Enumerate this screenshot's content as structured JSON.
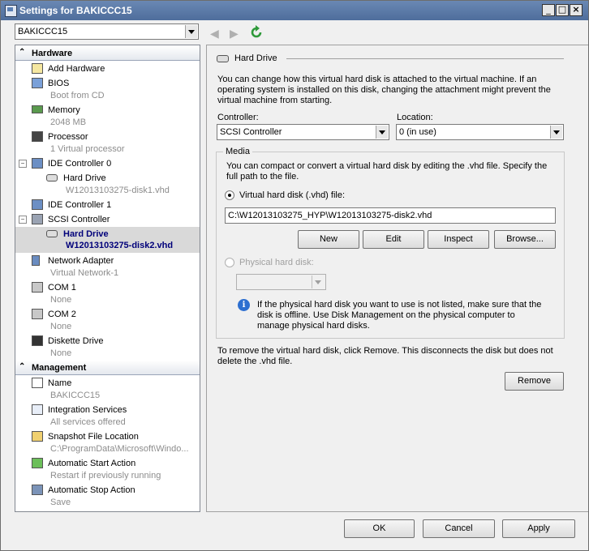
{
  "window": {
    "title": "Settings for BAKICCC15"
  },
  "vm_selector": {
    "value": "BAKICCC15"
  },
  "sidebar": {
    "hardware_header": "Hardware",
    "management_header": "Management",
    "hardware_items": [
      {
        "label": "Add Hardware",
        "sub": ""
      },
      {
        "label": "BIOS",
        "sub": "Boot from CD"
      },
      {
        "label": "Memory",
        "sub": "2048 MB"
      },
      {
        "label": "Processor",
        "sub": "1 Virtual processor"
      },
      {
        "label": "IDE Controller 0",
        "sub": ""
      },
      {
        "label": "Hard Drive",
        "sub": "W12013103275-disk1.vhd"
      },
      {
        "label": "IDE Controller 1",
        "sub": ""
      },
      {
        "label": "SCSI Controller",
        "sub": ""
      },
      {
        "label": "Hard Drive",
        "sub": "W12013103275-disk2.vhd"
      },
      {
        "label": "Network Adapter",
        "sub": "Virtual Network-1"
      },
      {
        "label": "COM 1",
        "sub": "None"
      },
      {
        "label": "COM 2",
        "sub": "None"
      },
      {
        "label": "Diskette Drive",
        "sub": "None"
      }
    ],
    "management_items": [
      {
        "label": "Name",
        "sub": "BAKICCC15"
      },
      {
        "label": "Integration Services",
        "sub": "All services offered"
      },
      {
        "label": "Snapshot File Location",
        "sub": "C:\\ProgramData\\Microsoft\\Windo..."
      },
      {
        "label": "Automatic Start Action",
        "sub": "Restart if previously running"
      },
      {
        "label": "Automatic Stop Action",
        "sub": "Save"
      }
    ]
  },
  "panel": {
    "title": "Hard Drive",
    "description": "You can change how this virtual hard disk is attached to the virtual machine. If an operating system is installed on this disk, changing the attachment might prevent the virtual machine from starting.",
    "controller_label": "Controller:",
    "controller_value": "SCSI Controller",
    "location_label": "Location:",
    "location_value": "0 (in use)",
    "media_label": "Media",
    "media_description": "You can compact or convert a virtual hard disk by editing the .vhd file. Specify the full path to the file.",
    "vhd_radio_label": "Virtual hard disk (.vhd) file:",
    "vhd_path": "C:\\W12013103275_HYP\\W12013103275-disk2.vhd",
    "new_button": "New",
    "edit_button": "Edit",
    "inspect_button": "Inspect",
    "browse_button": "Browse...",
    "physical_radio_label": "Physical hard disk:",
    "info_text": "If the physical hard disk you want to use is not listed, make sure that the disk is offline. Use Disk Management on the physical computer to manage physical hard disks.",
    "remove_description": "To remove the virtual hard disk, click Remove. This disconnects the disk but does not delete the .vhd file.",
    "remove_button": "Remove"
  },
  "footer": {
    "ok": "OK",
    "cancel": "Cancel",
    "apply": "Apply"
  }
}
